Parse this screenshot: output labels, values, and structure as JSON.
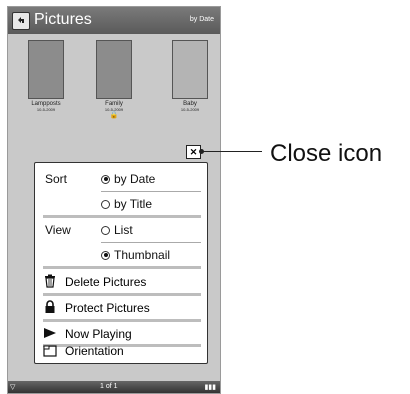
{
  "header": {
    "title": "Pictures",
    "sort_badge": "by Date"
  },
  "thumbnails": [
    {
      "name": "Lampposts",
      "date": "10-5-2009",
      "locked": false
    },
    {
      "name": "Family",
      "date": "10-5-2009",
      "locked": true
    },
    {
      "name": "Baby",
      "date": "10-5-2009",
      "locked": false
    }
  ],
  "menu": {
    "sort_label": "Sort",
    "sort_options": [
      "by Date",
      "by Title"
    ],
    "view_label": "View",
    "view_options": [
      "List",
      "Thumbnail"
    ],
    "actions": [
      "Delete Pictures",
      "Protect Pictures",
      "Now Playing",
      "Orientation"
    ]
  },
  "callout": {
    "text": "Close icon"
  },
  "footer": {
    "page": "1 of 1"
  },
  "colors": {
    "titlebar": "#6a6a6a",
    "screen": "#c9c9c9"
  }
}
